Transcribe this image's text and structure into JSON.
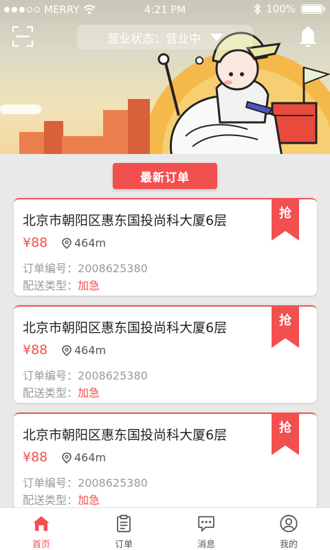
{
  "status_bar": {
    "carrier": "MERRY",
    "time": "4:21 PM",
    "battery": "100%"
  },
  "header": {
    "business_status": "营业状态：营业中"
  },
  "section": {
    "title": "最新订单"
  },
  "orders": [
    {
      "address": "北京市朝阳区惠东国投尚科大厦6层",
      "price": "¥88",
      "distance": "464m",
      "order_no_label": "订单编号：",
      "order_no": "2008625380",
      "delivery_label": "配送类型：",
      "delivery_type": "加急",
      "grab_label": "抢"
    },
    {
      "address": "北京市朝阳区惠东国投尚科大厦6层",
      "price": "¥88",
      "distance": "464m",
      "order_no_label": "订单编号：",
      "order_no": "2008625380",
      "delivery_label": "配送类型：",
      "delivery_type": "加急",
      "grab_label": "抢"
    },
    {
      "address": "北京市朝阳区惠东国投尚科大厦6层",
      "price": "¥88",
      "distance": "464m",
      "order_no_label": "订单编号：",
      "order_no": "2008625380",
      "delivery_label": "配送类型：",
      "delivery_type": "加急",
      "grab_label": "抢"
    }
  ],
  "tabs": [
    {
      "label": "首页",
      "icon": "home-icon",
      "active": true
    },
    {
      "label": "订单",
      "icon": "clipboard-icon",
      "active": false
    },
    {
      "label": "消息",
      "icon": "chat-icon",
      "active": false
    },
    {
      "label": "我的",
      "icon": "user-icon",
      "active": false
    }
  ],
  "colors": {
    "accent": "#f24f4f",
    "header_sun": "#f4b94a",
    "building": "#ec7f4e"
  }
}
